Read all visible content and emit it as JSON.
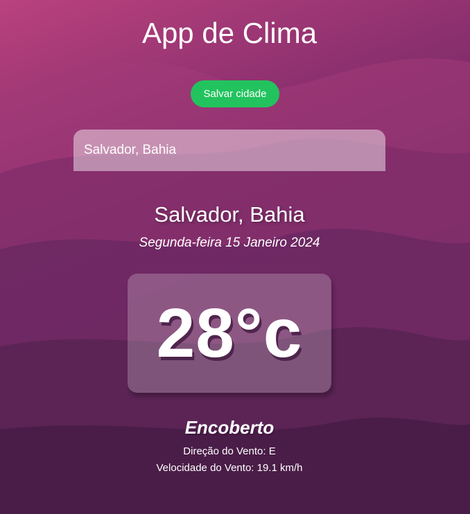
{
  "app": {
    "title": "App de Clima"
  },
  "actions": {
    "save_label": "Salvar cidade"
  },
  "search": {
    "value": "Salvador, Bahia"
  },
  "weather": {
    "location": "Salvador, Bahia",
    "date": "Segunda-feira 15 Janeiro 2024",
    "temperature": "28°c",
    "condition": "Encoberto",
    "wind_direction": "Direção do Vento: E",
    "wind_speed": "Velocidade do Vento: 19.1 km/h"
  },
  "colors": {
    "save_button": "#22c35e",
    "background_top": "#b9427e",
    "background_bottom": "#4e1f4f"
  }
}
